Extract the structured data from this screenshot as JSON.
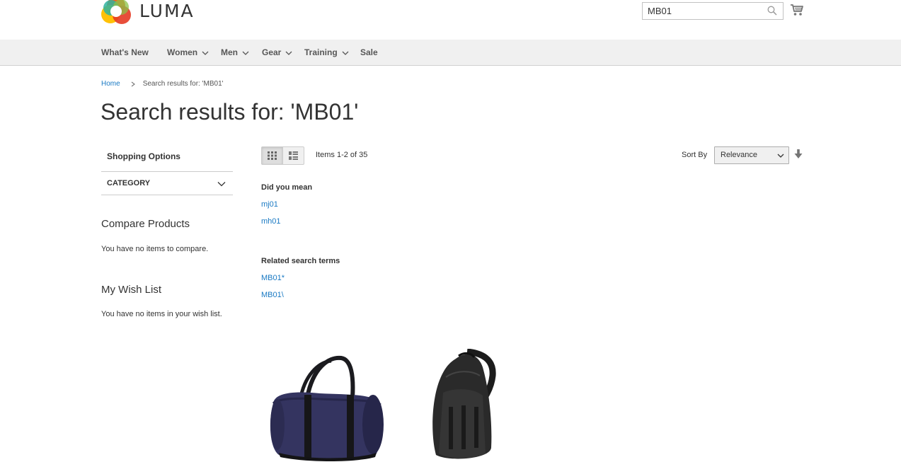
{
  "header": {
    "logo_text": "LUMA",
    "search": {
      "value": "MB01"
    }
  },
  "nav": {
    "items": [
      {
        "label": "What's New"
      },
      {
        "label": "Women"
      },
      {
        "label": "Men"
      },
      {
        "label": "Gear"
      },
      {
        "label": "Training"
      },
      {
        "label": "Sale"
      }
    ]
  },
  "breadcrumb": {
    "home": "Home",
    "current": "Search results for: 'MB01'"
  },
  "page": {
    "title": "Search results for: 'MB01'"
  },
  "sidebar": {
    "shopping_options": "Shopping Options",
    "category_filter": "CATEGORY",
    "compare": {
      "title": "Compare Products",
      "empty": "You have no items to compare."
    },
    "wishlist": {
      "title": "My Wish List",
      "empty": "You have no items in your wish list."
    }
  },
  "toolbar": {
    "amount": "Items 1-2 of 35",
    "sort_label": "Sort By",
    "sort_value": "Relevance"
  },
  "suggestions": {
    "did_you_mean_title": "Did you mean",
    "did_you_mean": [
      "mj01",
      "mh01"
    ],
    "related_title": "Related search terms",
    "related": [
      "MB01*",
      "MB01\\"
    ]
  },
  "colors": {
    "link": "#1979c3",
    "nav_bg": "#f0f0f0",
    "text": "#333333"
  }
}
